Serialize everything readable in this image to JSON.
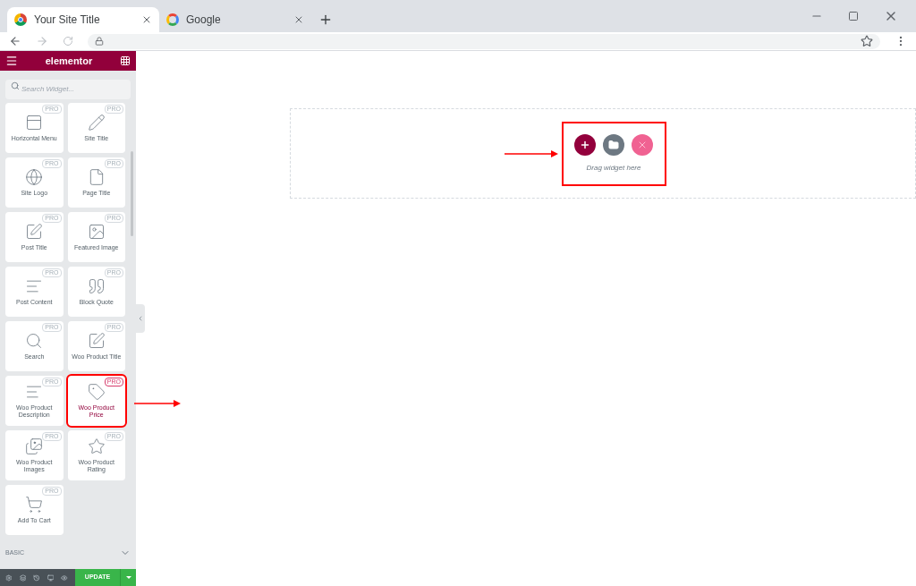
{
  "browser": {
    "tabs": [
      {
        "title": "Your Site Title",
        "selected": true,
        "kind": "chrome"
      },
      {
        "title": "Google",
        "selected": false,
        "kind": "google"
      }
    ]
  },
  "sidebar": {
    "brand": "elementor",
    "search": {
      "placeholder": "Search Widget..."
    },
    "widgets": [
      {
        "label": "Horizontal Menu",
        "badge": "PRO",
        "selected": false
      },
      {
        "label": "Site Title",
        "badge": "PRO",
        "selected": false
      },
      {
        "label": "Site Logo",
        "badge": "PRO",
        "selected": false
      },
      {
        "label": "Page Title",
        "badge": "PRO",
        "selected": false
      },
      {
        "label": "Post Title",
        "badge": "PRO",
        "selected": false
      },
      {
        "label": "Featured Image",
        "badge": "PRO",
        "selected": false
      },
      {
        "label": "Post Content",
        "badge": "PRO",
        "selected": false
      },
      {
        "label": "Block Quote",
        "badge": "PRO",
        "selected": false
      },
      {
        "label": "Search",
        "badge": "PRO",
        "selected": false
      },
      {
        "label": "Woo Product Title",
        "badge": "PRO",
        "selected": false
      },
      {
        "label": "Woo Product Description",
        "badge": "PRO",
        "selected": false
      },
      {
        "label": "Woo Product Price",
        "badge": "PRO",
        "selected": true
      },
      {
        "label": "Woo Product Images",
        "badge": "PRO",
        "selected": false
      },
      {
        "label": "Woo Product Rating",
        "badge": "PRO",
        "selected": false
      },
      {
        "label": "Add To Cart",
        "badge": "PRO",
        "selected": false
      }
    ],
    "section": {
      "label": "BASIC",
      "expanded": false
    },
    "update_button": "UPDATE"
  },
  "canvas": {
    "drop_hint": "Drag widget here"
  }
}
